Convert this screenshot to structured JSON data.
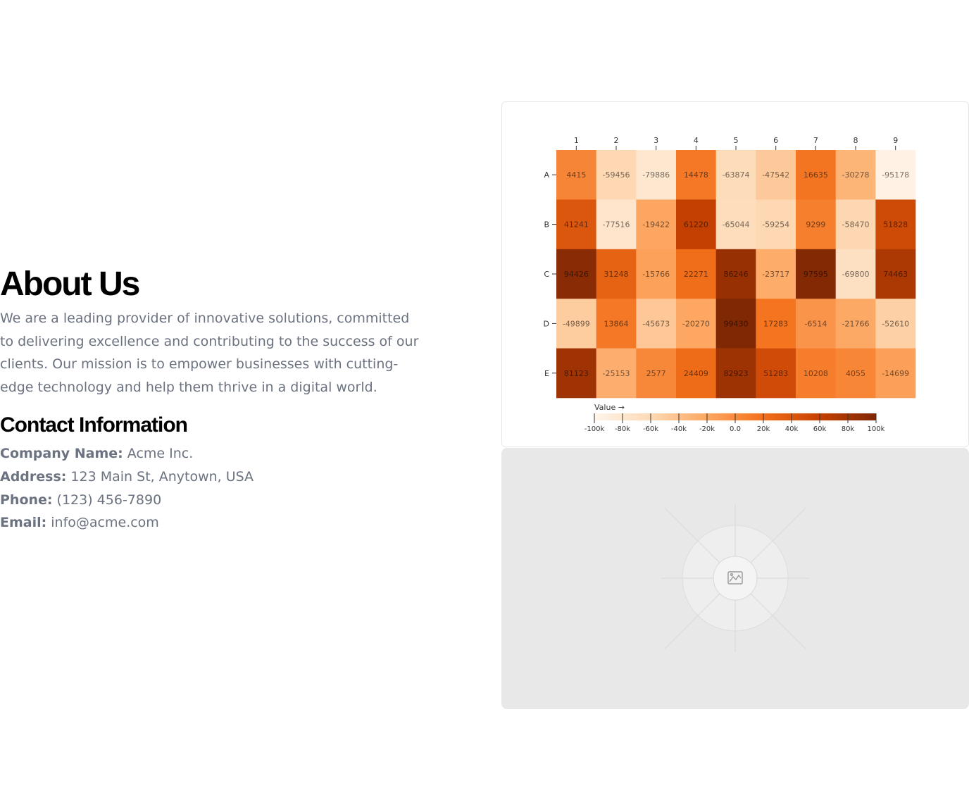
{
  "about": {
    "title": "About Us",
    "intro": "We are a leading provider of innovative solutions, committed to delivering excellence and contributing to the success of our clients. Our mission is to empower businesses with cutting-edge technology and help them thrive in a digital world."
  },
  "contact": {
    "heading": "Contact Information",
    "items": [
      {
        "label": "Company Name:",
        "value": " Acme Inc."
      },
      {
        "label": "Address:",
        "value": " 123 Main St, Anytown, USA"
      },
      {
        "label": "Phone:",
        "value": " (123) 456-7890"
      },
      {
        "label": "Email:",
        "value": " info@acme.com"
      }
    ]
  },
  "chart_data": {
    "type": "heatmap",
    "x_categories": [
      "1",
      "2",
      "3",
      "4",
      "5",
      "6",
      "7",
      "8",
      "9"
    ],
    "y_categories": [
      "A",
      "B",
      "C",
      "D",
      "E"
    ],
    "values": [
      [
        4415,
        -59456,
        -79886,
        14478,
        -63874,
        -47542,
        16635,
        -30278,
        -95178
      ],
      [
        41241,
        -77516,
        -19422,
        61220,
        -65044,
        -59254,
        9299,
        -58470,
        51828
      ],
      [
        94426,
        31248,
        -15766,
        22271,
        86246,
        -23717,
        97595,
        -69800,
        74463
      ],
      [
        -49899,
        13864,
        -45673,
        -20270,
        99430,
        17283,
        -6514,
        -21766,
        -52610
      ],
      [
        81123,
        -25153,
        2577,
        24409,
        82923,
        51283,
        10208,
        4055,
        -14699
      ]
    ],
    "legend": {
      "title": "Value →",
      "domain": [
        -100000,
        100000
      ],
      "tick_values": [
        -100000,
        -80000,
        -60000,
        -40000,
        -20000,
        0,
        20000,
        40000,
        60000,
        80000,
        100000
      ],
      "tick_labels": [
        "-100k",
        "-80k",
        "-60k",
        "-40k",
        "-20k",
        "0.0",
        "20k",
        "40k",
        "60k",
        "80k",
        "100k"
      ]
    },
    "color_scheme": [
      "#fff5eb",
      "#fdd9b4",
      "#fda762",
      "#f3701b",
      "#c54102",
      "#7f2704"
    ]
  }
}
